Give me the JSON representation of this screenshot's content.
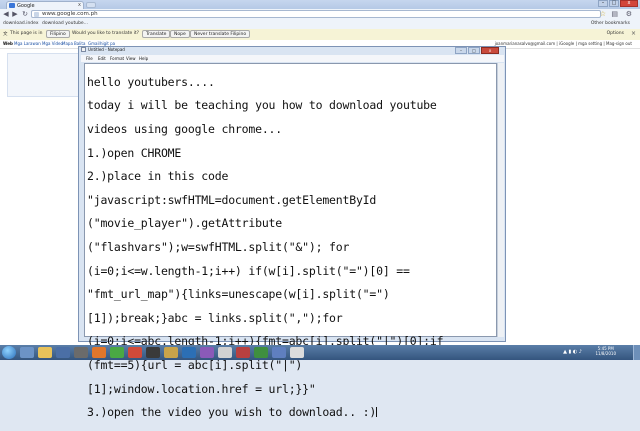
{
  "browser": {
    "tab_title": "Google",
    "tab_close": "x",
    "address": "www.google.com.ph",
    "window_buttons": {
      "min": "–",
      "max": "□",
      "close": "x"
    }
  },
  "bookmarks": {
    "items": [
      "download.index",
      "download youtube..."
    ],
    "other": "Other bookmarks"
  },
  "translate_bar": {
    "message": "This page is in",
    "language": "Filipino",
    "question": "Would you like to translate it?",
    "translate_button": "Translate",
    "nope_button": "Nope",
    "never_button": "Never translate Filipino",
    "options": "Options"
  },
  "google_bar": {
    "links": [
      "Web",
      "Mga Larawan",
      "Mga Video",
      "Mapa",
      "Balita",
      "Gmail",
      "higit pa"
    ],
    "user": "joanmarianasalvo@gmail.com | iGoogle | mga setting | Mag-sign out"
  },
  "notepad": {
    "title": "Untitled - Notepad",
    "menu": [
      "File",
      "Edit",
      "Format",
      "View",
      "Help"
    ],
    "lines": [
      "hello youtubers....",
      "today i will be teaching you how to download youtube",
      "videos using google chrome...",
      "1.)open CHROME",
      "2.)place in this code",
      "\"javascript:swfHTML=document.getElementById",
      "(\"movie_player\").getAttribute",
      "(\"flashvars\");w=swfHTML.split(\"&\"); for",
      "(i=0;i<=w.length-1;i++) if(w[i].split(\"=\")[0] ==",
      "\"fmt_url_map\"){links=unescape(w[i].split(\"=\")",
      "[1]);break;}abc = links.split(\",\");for",
      "(i=0;i<=abc.length-1;i++){fmt=abc[i].split(\"|\")[0];if",
      "(fmt==5){url = abc[i].split(\"|\")",
      "[1];window.location.href = url;}}\"",
      "3.)open the video you wish to download.. :)"
    ]
  },
  "taskbar": {
    "time": "5:45 PM",
    "date": "11/8/2010"
  }
}
